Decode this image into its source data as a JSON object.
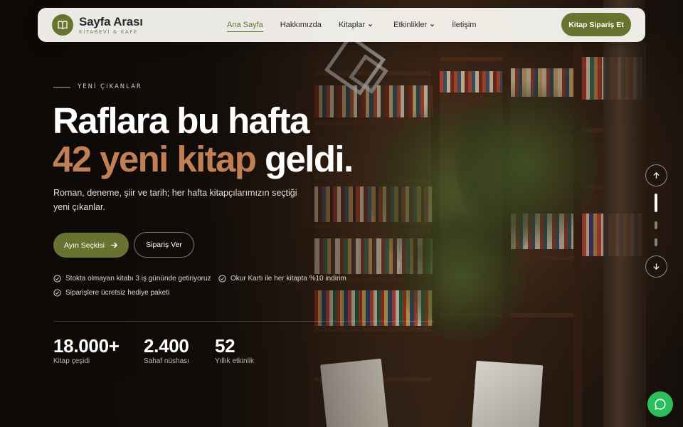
{
  "brand": {
    "name": "Sayfa Arası",
    "subtitle": "KİTABEVİ & KAFE",
    "logo_icon": "book-icon"
  },
  "nav": {
    "items": [
      {
        "label": "Ana Sayfa",
        "active": true
      },
      {
        "label": "Hakkımızda"
      },
      {
        "label": "Kitaplar",
        "dropdown": true
      },
      {
        "label": "Etkinlikler",
        "dropdown": true
      },
      {
        "label": "İletişim"
      }
    ],
    "cta_label": "Kitap Sipariş Et"
  },
  "hero": {
    "eyebrow": "YENİ ÇIKANLAR",
    "headline_line1": "Raflara bu hafta",
    "headline_accent": "42 yeni kitap",
    "headline_rest": "geldi.",
    "lead": "Roman, deneme, şiir ve tarih; her hafta kitapçılarımızın seçtiği yeni çıkanlar.",
    "primary_label": "Ayın Seçkisi",
    "secondary_label": "Sipariş Ver",
    "features": [
      "Stokta olmayan kitabı 3 iş gününde getiriyoruz",
      "Okur Kartı ile her kitapta %10 indirim",
      "Siparişlere ücretsiz hediye paketi"
    ],
    "stats": [
      {
        "value": "18.000+",
        "label": "Kitap çeşidi"
      },
      {
        "value": "2.400",
        "label": "Sahaf nüshası"
      },
      {
        "value": "52",
        "label": "Yıllık etkinlik"
      }
    ]
  },
  "slider": {
    "slides": 4,
    "active_slide": 1
  },
  "colors": {
    "accent": "#67732e",
    "highlight": "#c07f54",
    "navbar_bg": "#f6f4ee",
    "whatsapp": "#2bbf5c"
  }
}
